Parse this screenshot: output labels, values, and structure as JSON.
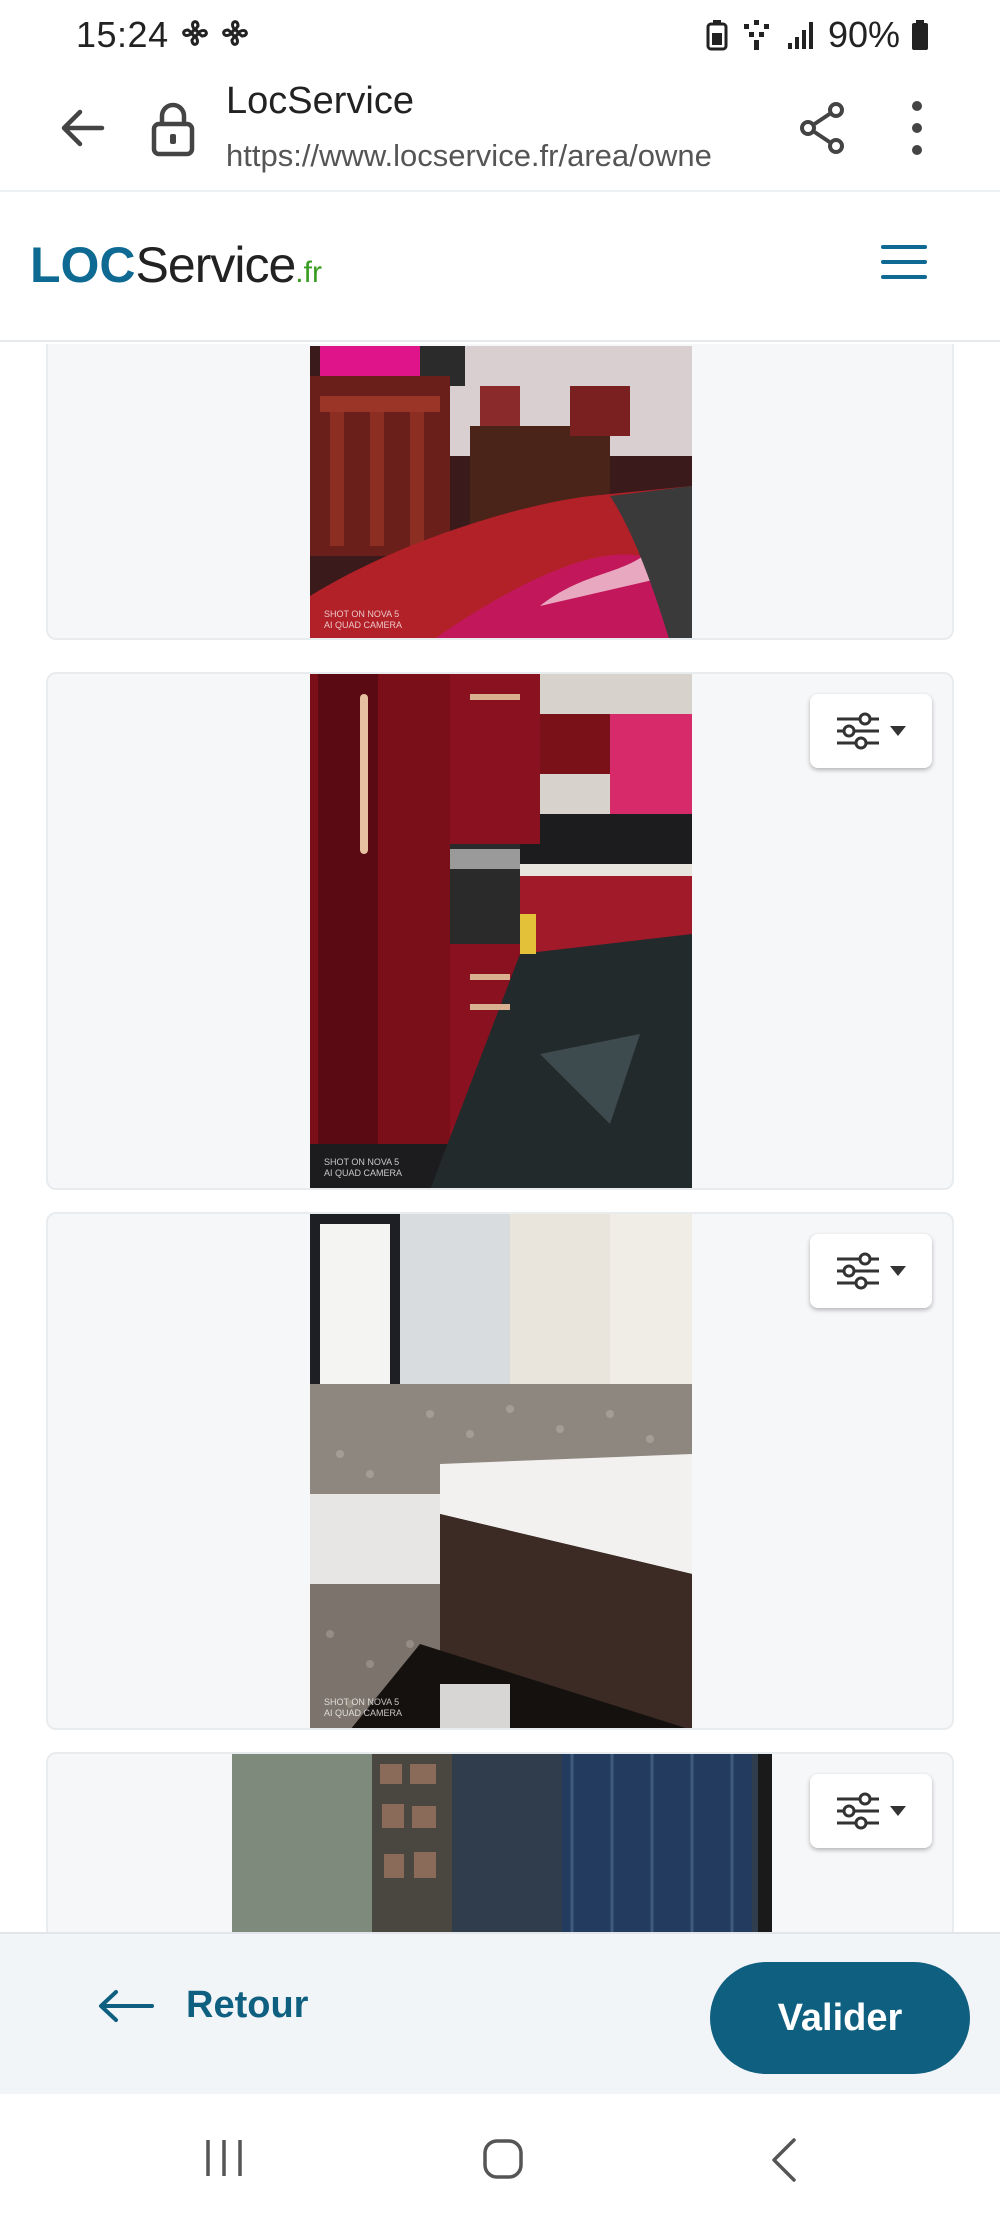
{
  "status_bar": {
    "time": "15:24",
    "battery": "90%"
  },
  "browser": {
    "title": "LocService",
    "url": "https://www.locservice.fr/area/owne"
  },
  "site": {
    "logo_loc": "LOC",
    "logo_service": "Service",
    "logo_fr": ".fr"
  },
  "photos": [
    {
      "subject": "living-room",
      "caption_line1": "SHOT ON NOVA 5",
      "caption_line2": "AI QUAD CAMERA",
      "has_options": false
    },
    {
      "subject": "kitchen",
      "caption_line1": "SHOT ON NOVA 5",
      "caption_line2": "AI QUAD CAMERA",
      "has_options": true
    },
    {
      "subject": "bathroom",
      "caption_line1": "SHOT ON NOVA 5",
      "caption_line2": "AI QUAD CAMERA",
      "has_options": true
    },
    {
      "subject": "room-window",
      "caption_line1": "",
      "caption_line2": "",
      "has_options": true
    }
  ],
  "actions": {
    "back_label": "Retour",
    "submit_label": "Valider"
  },
  "colors": {
    "brand_blue": "#0f5f80",
    "logo_blue": "#0f6a93",
    "logo_green": "#3a9d23",
    "card_bg": "#f6f7f9",
    "action_bar_bg": "#f2f5f8"
  }
}
